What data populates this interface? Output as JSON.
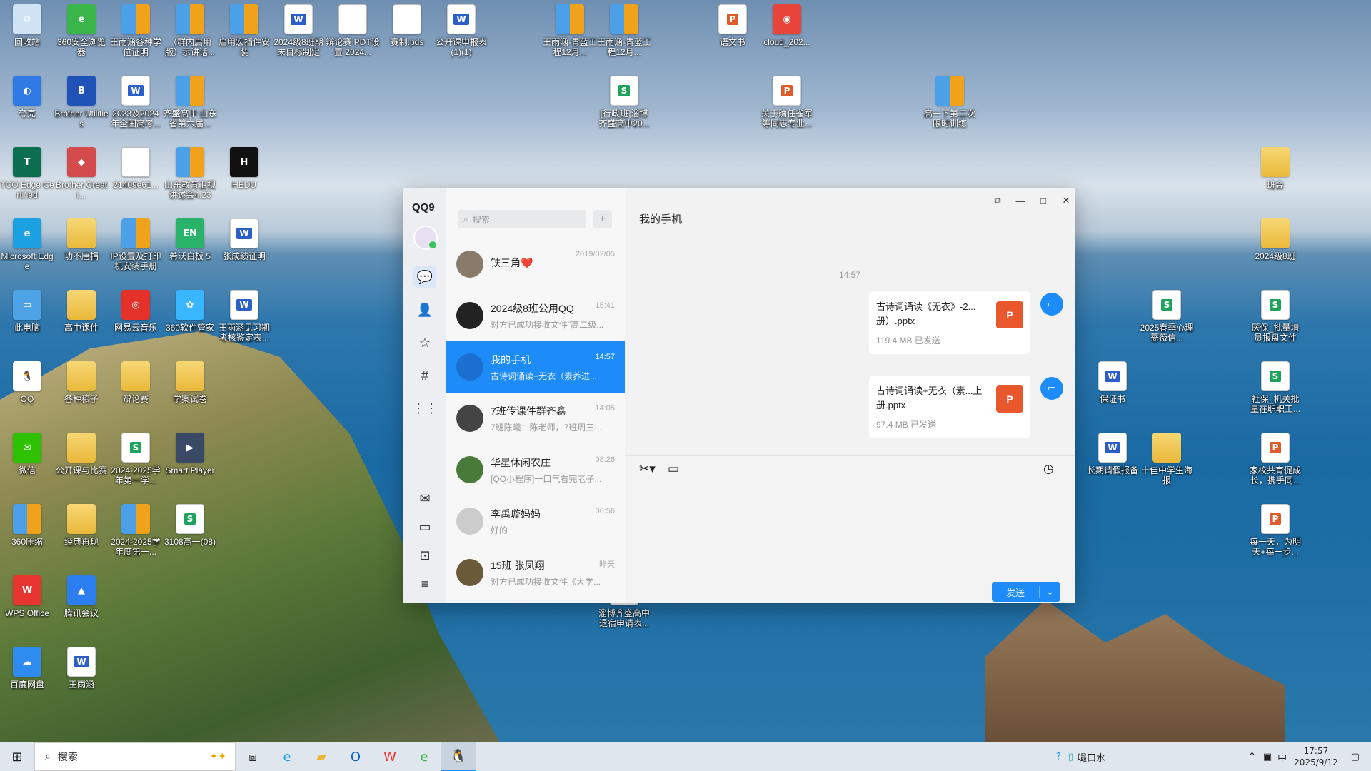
{
  "desktop": {
    "icons": [
      {
        "label": "回收站",
        "type": "app",
        "color": "#cfe3f5",
        "glyph": "♻"
      },
      {
        "label": "360安全浏览器",
        "type": "app",
        "color": "#39b54a",
        "glyph": "e"
      },
      {
        "label": "王雨涵各种学位证明",
        "type": "zip",
        "glyph": ""
      },
      {
        "label": "（群内启用版）示讲话...",
        "type": "zip",
        "glyph": ""
      },
      {
        "label": "启用宏插件安装",
        "type": "zip",
        "glyph": ""
      },
      {
        "label": "2024级8班期末目标制定",
        "type": "word",
        "glyph": "W"
      },
      {
        "label": "辩论赛 PDT设置 2024...",
        "type": "file",
        "glyph": ""
      },
      {
        "label": "赛制.pds",
        "type": "file",
        "glyph": ""
      },
      {
        "label": "公开课申报表(1)(1)",
        "type": "word",
        "glyph": "W"
      },
      {
        "label": "王雨涵-青蓝工程12月...",
        "type": "zip",
        "glyph": ""
      },
      {
        "label": "王雨涵-青蓝工程12月...",
        "type": "zip",
        "glyph": ""
      },
      {
        "label": "语文书",
        "type": "ppt",
        "glyph": "P"
      },
      {
        "label": "cloud_202...",
        "type": "app",
        "color": "#e9443a",
        "glyph": "◉"
      },
      {
        "label": "夸克",
        "type": "app",
        "color": "#2f7ae5",
        "glyph": "◐"
      },
      {
        "label": "Brother Utilities",
        "type": "app",
        "color": "#1f53b8",
        "glyph": "B"
      },
      {
        "label": "2023及2024年全国高考...",
        "type": "word",
        "glyph": "W"
      },
      {
        "label": "齐盛高中 山东省第六届...",
        "type": "zip",
        "glyph": ""
      },
      {
        "label": "[行政班]淄博齐盛高中20...",
        "type": "sheet",
        "glyph": "S"
      },
      {
        "label": "关于确任雀军等同志专业...",
        "type": "ppt",
        "glyph": "P"
      },
      {
        "label": "高一下第二次限时训练",
        "type": "zip",
        "glyph": ""
      },
      {
        "label": "TCO Edge Certified",
        "type": "app",
        "color": "#0b6e4f",
        "glyph": "T"
      },
      {
        "label": "Brother Creati...",
        "type": "app",
        "color": "#d34b4b",
        "glyph": "◆"
      },
      {
        "label": "21409e61...",
        "type": "file",
        "glyph": ""
      },
      {
        "label": "山东教育卫视讲述会4.23",
        "type": "zip",
        "glyph": ""
      },
      {
        "label": "HEDU",
        "type": "app",
        "color": "#111111",
        "glyph": "H"
      },
      {
        "label": "班会",
        "type": "folder",
        "glyph": ""
      },
      {
        "label": "Microsoft Edge",
        "type": "app",
        "color": "#1ba1e2",
        "glyph": "e"
      },
      {
        "label": "功不唐捐",
        "type": "folder",
        "glyph": ""
      },
      {
        "label": "IP设置及打印机安装手册",
        "type": "zip",
        "glyph": ""
      },
      {
        "label": "希沃白板 5",
        "type": "app",
        "color": "#28b26a",
        "glyph": "EN"
      },
      {
        "label": "张成绩证明",
        "type": "word",
        "glyph": "W"
      },
      {
        "label": "2024级8班",
        "type": "folder",
        "glyph": ""
      },
      {
        "label": "此电脑",
        "type": "app",
        "color": "#4da3e6",
        "glyph": "▭"
      },
      {
        "label": "高中课件",
        "type": "folder",
        "glyph": ""
      },
      {
        "label": "网易云音乐",
        "type": "app",
        "color": "#e4322b",
        "glyph": "◎"
      },
      {
        "label": "360软件管家",
        "type": "app",
        "color": "#38b6ff",
        "glyph": "✿"
      },
      {
        "label": "王雨涵见习期考核鉴定表...",
        "type": "word",
        "glyph": "W"
      },
      {
        "label": "2025春季心理蔷薇信...",
        "type": "sheet",
        "glyph": "S"
      },
      {
        "label": "医保_批量增员报盘文件",
        "type": "sheet",
        "glyph": "S"
      },
      {
        "label": "QQ",
        "type": "app",
        "color": "#ffffff",
        "glyph": "🐧"
      },
      {
        "label": "各种稿子",
        "type": "folder",
        "glyph": ""
      },
      {
        "label": "辩论赛",
        "type": "folder",
        "glyph": ""
      },
      {
        "label": "学案试卷",
        "type": "folder",
        "glyph": ""
      },
      {
        "label": "保证书",
        "type": "word",
        "glyph": "W"
      },
      {
        "label": "社保_机关批量在职职工...",
        "type": "sheet",
        "glyph": "S"
      },
      {
        "label": "微信",
        "type": "app",
        "color": "#2dc100",
        "glyph": "✉"
      },
      {
        "label": "公开课与比赛",
        "type": "folder",
        "glyph": ""
      },
      {
        "label": "2024-2025学年第一学...",
        "type": "sheet",
        "glyph": "S"
      },
      {
        "label": "Smart Player",
        "type": "app",
        "color": "#3a4a66",
        "glyph": "▶"
      },
      {
        "label": "长期请假报备",
        "type": "word",
        "glyph": "W"
      },
      {
        "label": "十佳中学生海报",
        "type": "folder",
        "glyph": ""
      },
      {
        "label": "家校共育促成长，携手同...",
        "type": "ppt",
        "glyph": "P"
      },
      {
        "label": "360压缩",
        "type": "zip",
        "glyph": ""
      },
      {
        "label": "经典再现",
        "type": "folder",
        "glyph": ""
      },
      {
        "label": "2024-2025学年度第一...",
        "type": "zip",
        "glyph": ""
      },
      {
        "label": "3108高一(08)",
        "type": "sheet",
        "glyph": "S"
      },
      {
        "label": "每一天，为明天+每一步...",
        "type": "ppt",
        "glyph": "P"
      },
      {
        "label": "WPS Office",
        "type": "app",
        "color": "#e8352f",
        "glyph": "W"
      },
      {
        "label": "腾讯会议",
        "type": "app",
        "color": "#2a7ef0",
        "glyph": "▲"
      },
      {
        "label": "淄博齐盛高中退宿申请表...",
        "type": "word",
        "glyph": "W"
      },
      {
        "label": "百度网盘",
        "type": "app",
        "color": "#2e8cf0",
        "glyph": "☁"
      },
      {
        "label": "王雨涵",
        "type": "word",
        "glyph": "W"
      }
    ]
  },
  "qq": {
    "logo": "QQ9",
    "search_placeholder": "搜索",
    "chat_title": "我的手机",
    "conversations": [
      {
        "name": "铁三角❤️",
        "preview": "",
        "time": "2019/02/05",
        "color": "#8a7a6a"
      },
      {
        "name": "2024级8班公用QQ",
        "preview": "对方已成功接收文件\"高二级...",
        "time": "15:41",
        "color": "#222222"
      },
      {
        "name": "我的手机",
        "preview": "古诗词诵读+无衣（素养进...",
        "time": "14:57",
        "color": "#1a6fd0"
      },
      {
        "name": "7班传课件群齐鑫",
        "preview": "7班陈曦：陈老师，7班周三...",
        "time": "14:05",
        "color": "#444444"
      },
      {
        "name": "华星休闲农庄",
        "preview": "[QQ小程序]一口气看完老子...",
        "time": "08:26",
        "color": "#4a7a3a"
      },
      {
        "name": "李禹璇妈妈",
        "preview": "好的",
        "time": "06:56",
        "color": "#cccccc"
      },
      {
        "name": "15班 张凤翔",
        "preview": "对方已成功接收文件《大学...",
        "time": "昨天",
        "color": "#6a5a3a"
      }
    ],
    "timestamp": "14:57",
    "messages": [
      {
        "file": "古诗词诵读《无衣》-2...册）.pptx",
        "size": "119.4 MB",
        "status": "已发送"
      },
      {
        "file": "古诗词诵读+无衣（素...上册.pptx",
        "size": "97.4 MB",
        "status": "已发送"
      }
    ],
    "send_label": "发送"
  },
  "taskbar": {
    "search": "搜索",
    "weather": "嘬口水",
    "ime": "中",
    "time": "17:57",
    "date": "2025/9/12"
  }
}
